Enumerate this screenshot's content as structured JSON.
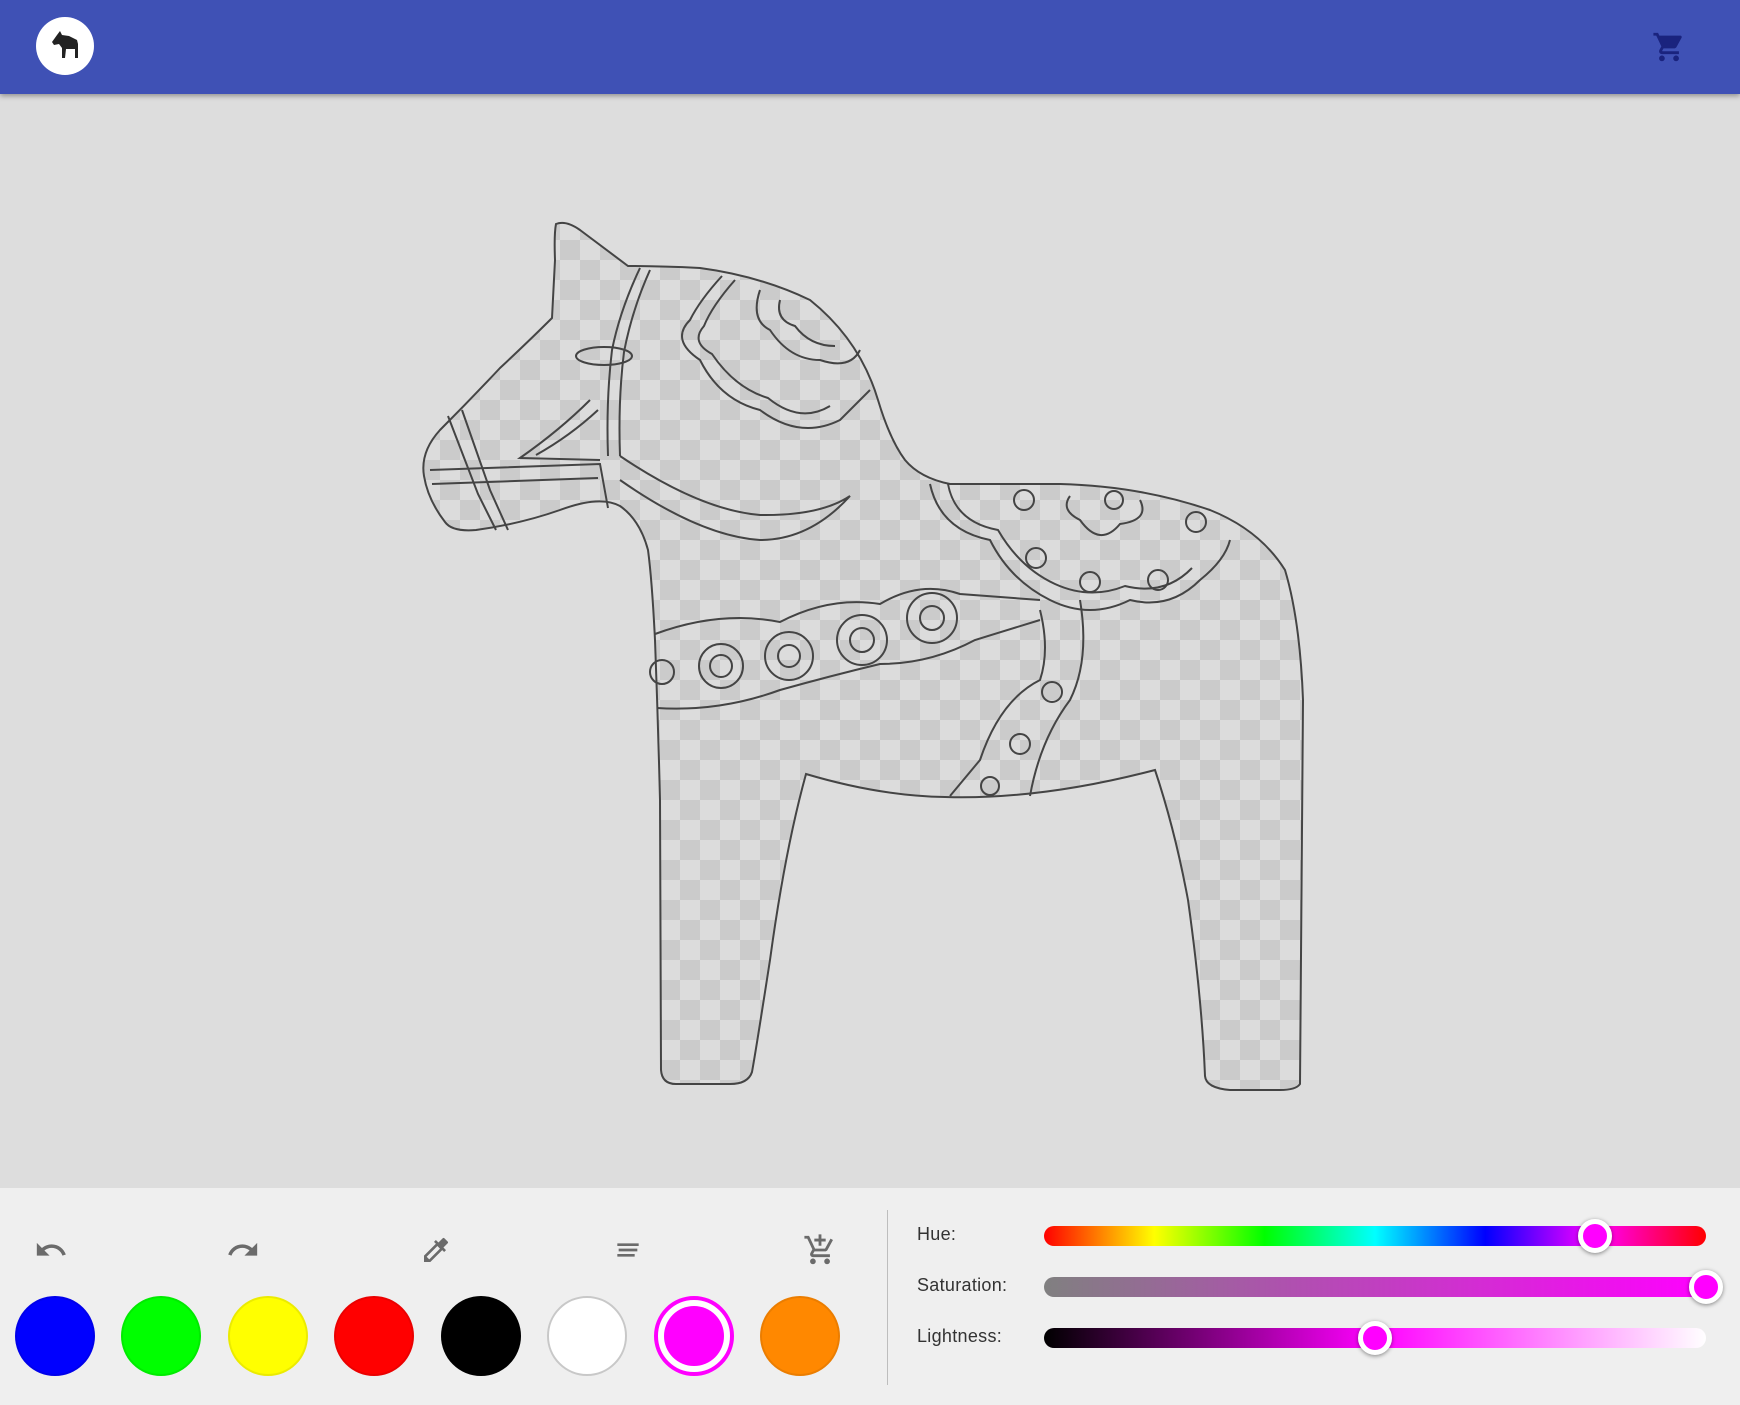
{
  "app": {
    "logo_icon": "horse-icon",
    "cart_icon": "shopping-cart-icon"
  },
  "toolbar": {
    "tools": [
      {
        "name": "undo-icon"
      },
      {
        "name": "redo-icon"
      },
      {
        "name": "eyedropper-icon"
      },
      {
        "name": "menu-lines-icon"
      },
      {
        "name": "add-to-cart-icon"
      }
    ]
  },
  "palette": [
    {
      "color": "#0000ff"
    },
    {
      "color": "#00ff00"
    },
    {
      "color": "#ffff00"
    },
    {
      "color": "#ff0000"
    },
    {
      "color": "#000000"
    },
    {
      "color": "#ffffff"
    },
    {
      "color": "#ff00ff",
      "selected": true
    },
    {
      "color": "#ff8800"
    }
  ],
  "sliders": {
    "hue": {
      "label": "Hue:",
      "value_fraction": 0.833
    },
    "saturation": {
      "label": "Saturation:",
      "value_fraction": 1.0
    },
    "lightness": {
      "label": "Lightness:",
      "value_fraction": 0.5
    }
  },
  "colors": {
    "appbar": "#3f51b5",
    "selected": "#ff00ff"
  }
}
